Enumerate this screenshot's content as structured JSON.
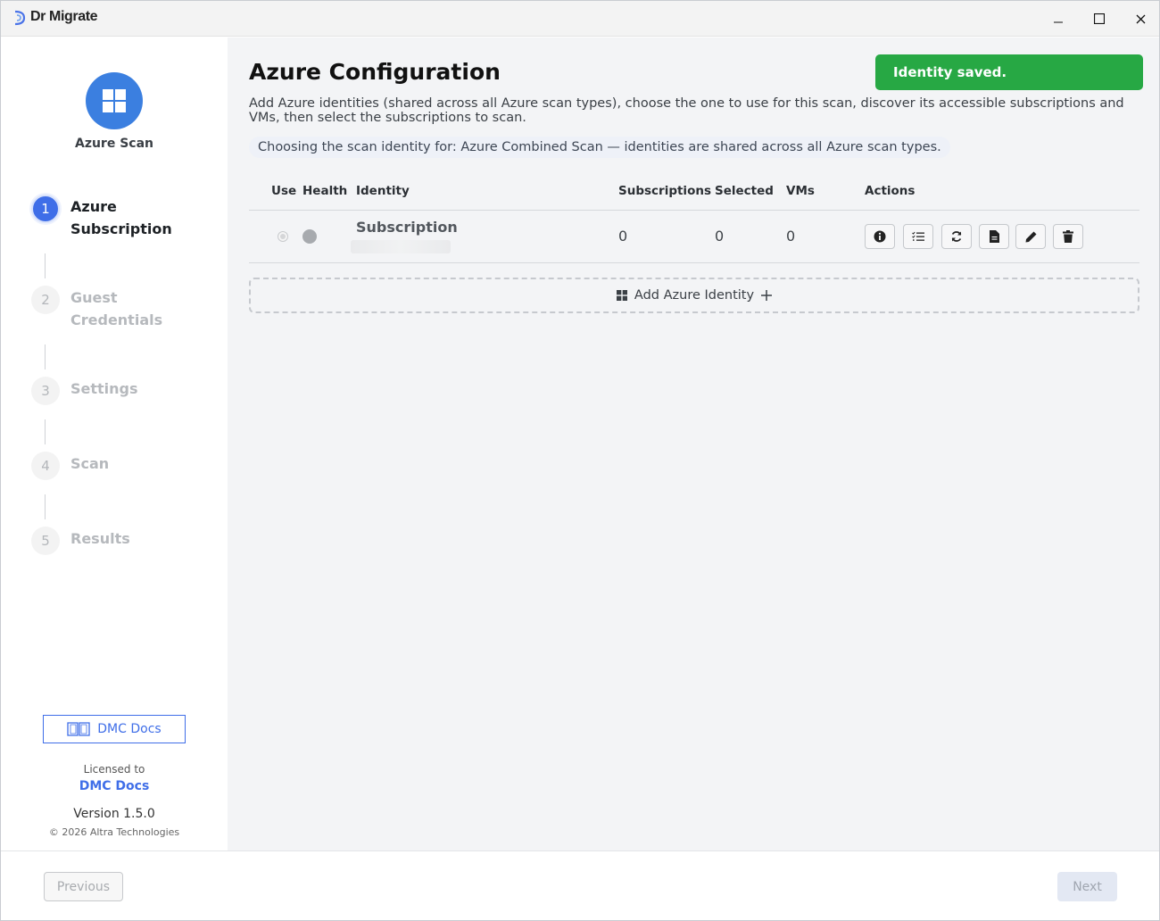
{
  "window": {
    "app_title": "Dr Migrate",
    "controls": {
      "minimize": "–",
      "maximize": "☐",
      "close": "✕"
    }
  },
  "sidebar": {
    "scan_type": "Azure Scan",
    "scan_icon": "windows-grid-icon",
    "steps": [
      {
        "num": "1",
        "line1": "Azure",
        "line2": "Subscription",
        "state": "active"
      },
      {
        "num": "2",
        "line1": "Guest",
        "line2": "Credentials",
        "state": "inactive"
      },
      {
        "num": "3",
        "line1": "Settings",
        "line2": "",
        "state": "inactive"
      },
      {
        "num": "4",
        "line1": "Scan",
        "line2": "",
        "state": "inactive"
      },
      {
        "num": "5",
        "line1": "Results",
        "line2": "",
        "state": "inactive"
      }
    ],
    "docs_button": "DMC Docs",
    "licensed_label": "Licensed to",
    "licensee": "DMC Docs",
    "version": "Version 1.5.0",
    "copyright": "© 2026 Altra Technologies"
  },
  "main": {
    "title": "Azure Configuration",
    "toast": "Identity saved.",
    "description": "Add Azure identities (shared across all Azure scan types), choose the one to use for this scan, discover its accessible subscriptions and VMs, then select the subscriptions to scan.",
    "hint": "Choosing the scan identity for: Azure Combined Scan — identities are shared across all Azure scan types.",
    "table": {
      "headers": {
        "use": "Use",
        "health": "Health",
        "identity": "Identity",
        "subscriptions": "Subscriptions",
        "selected": "Selected",
        "vms": "VMs",
        "actions": "Actions"
      },
      "rows": [
        {
          "identity": "Subscription",
          "subscriptions": "0",
          "selected": "0",
          "vms": "0",
          "actions": [
            "info-icon",
            "checklist-icon",
            "refresh-icon",
            "document-icon",
            "edit-icon",
            "trash-icon"
          ]
        }
      ]
    },
    "add_identity": "Add Azure Identity"
  },
  "footer": {
    "previous": "Previous",
    "next": "Next"
  },
  "colors": {
    "accent": "#3f6ee8",
    "toast": "#27a844",
    "main_bg": "#f3f4f6"
  }
}
